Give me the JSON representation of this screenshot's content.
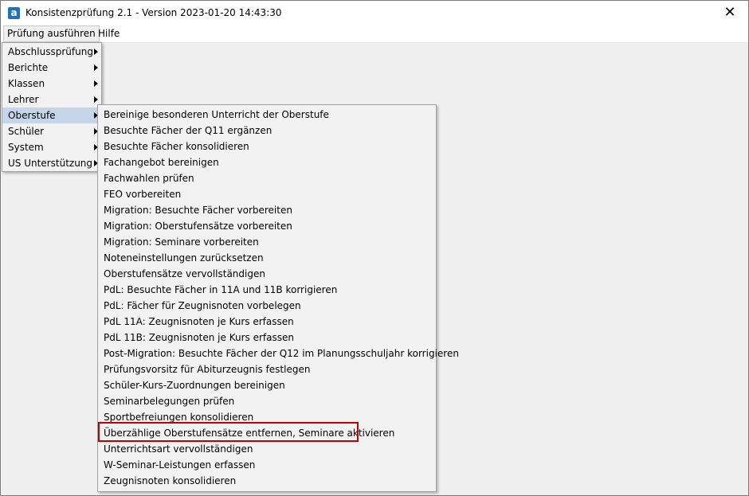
{
  "window": {
    "app_icon_letter": "a",
    "title": "Konsistenzprüfung 2.1 - Version 2023-01-20 14:43:30",
    "close_symbol": "✕"
  },
  "menubar": {
    "items": [
      "Prüfung ausführen",
      "Hilfe"
    ]
  },
  "main_menu": {
    "items": [
      "Abschlussprüfung",
      "Berichte",
      "Klassen",
      "Lehrer",
      "Oberstufe",
      "Schüler",
      "System",
      "US Unterstützung"
    ],
    "highlighted": "Oberstufe"
  },
  "submenu": {
    "items": [
      "Bereinige besonderen Unterricht der Oberstufe",
      "Besuchte Fächer der Q11 ergänzen",
      "Besuchte Fächer konsolidieren",
      "Fachangebot bereinigen",
      "Fachwahlen prüfen",
      "FEO vorbereiten",
      "Migration: Besuchte Fächer vorbereiten",
      "Migration: Oberstufensätze vorbereiten",
      "Migration: Seminare vorbereiten",
      "Noteneinstellungen zurücksetzen",
      "Oberstufensätze vervollständigen",
      "PdL: Besuchte Fächer in 11A und 11B korrigieren",
      "PdL: Fächer für Zeugnisnoten vorbelegen",
      "PdL 11A: Zeugnisnoten je Kurs erfassen",
      "PdL 11B: Zeugnisnoten je Kurs erfassen",
      "Post-Migration: Besuchte Fächer der Q12 im Planungsschuljahr korrigieren",
      "Prüfungsvorsitz für Abiturzeugnis festlegen",
      "Schüler-Kurs-Zuordnungen bereinigen",
      "Seminarbelegungen prüfen",
      "Sportbefreiungen konsolidieren",
      "Überzählige Oberstufensätze entfernen, Seminare aktivieren",
      "Unterrichtsart vervollständigen",
      "W-Seminar-Leistungen erfassen",
      "Zeugnisnoten konsolidieren"
    ]
  },
  "colors": {
    "menu_hover": "#c5d5ea",
    "highlight_border": "#c00000",
    "app_icon": "#1e73be"
  }
}
